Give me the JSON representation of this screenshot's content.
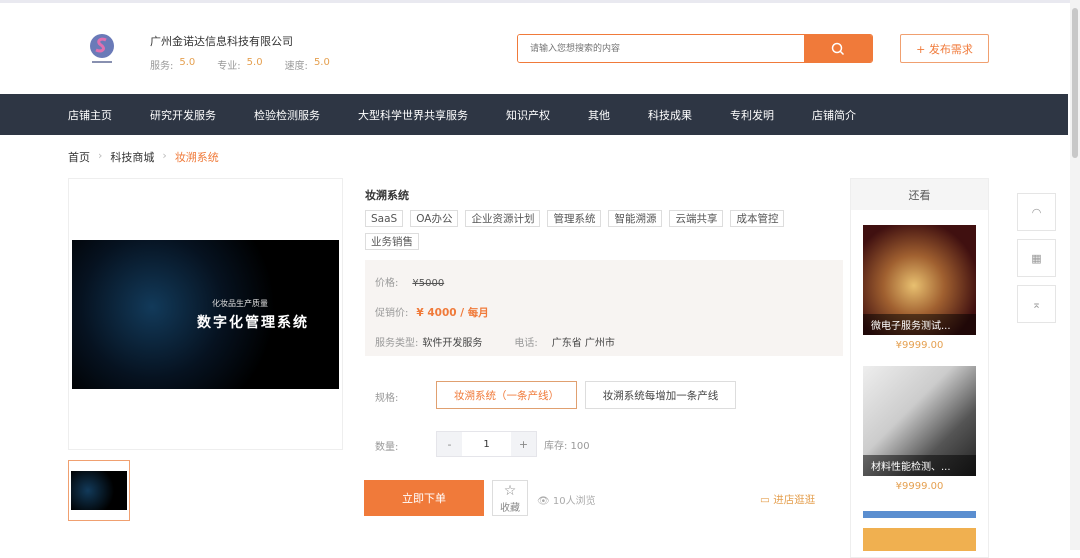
{
  "header": {
    "company": "广州金诺达信息科技有限公司",
    "ratings": [
      {
        "label": "服务:",
        "value": "5.0"
      },
      {
        "label": "专业:",
        "value": "5.0"
      },
      {
        "label": "速度:",
        "value": "5.0"
      }
    ],
    "search_placeholder": "请输入您想搜索的内容",
    "publish_label": "+ 发布需求"
  },
  "nav": [
    "店铺主页",
    "研究开发服务",
    "检验检测服务",
    "大型科学世界共享服务",
    "知识产权",
    "其他",
    "科技成果",
    "专利发明",
    "店铺简介"
  ],
  "breadcrumb": [
    "首页",
    "科技商城",
    "妆溯系统"
  ],
  "image": {
    "line1": "化妆品生产质量",
    "line2": "数字化管理系统"
  },
  "product": {
    "title": "妆溯系统",
    "tags": [
      "SaaS",
      "OA办公",
      "企业资源计划",
      "管理系统",
      "智能溯源",
      "云端共享",
      "成本管控",
      "业务销售"
    ],
    "price_label": "价格:",
    "price": "¥5000",
    "promo_label": "促销价:",
    "promo": "¥ 4000 / 每月",
    "type_label": "服务类型:",
    "type": "软件开发服务",
    "phone_label": "电话:",
    "phone": "广东省 广州市",
    "spec_label": "规格:",
    "specs": [
      "妆溯系统（一条产线）",
      "妆溯系统每增加一条产线"
    ],
    "qty_label": "数量:",
    "qty": "1",
    "minus": "-",
    "plus": "+",
    "stock": "库存: 100",
    "buy_label": "立即下单",
    "fav_label": "收藏",
    "views": "10人浏览",
    "shop_label": "进店逛逛"
  },
  "sidebar": {
    "title": "还看",
    "items": [
      {
        "name": "微电子服务测试...",
        "price": "¥9999.00"
      },
      {
        "name": "材料性能检测、...",
        "price": "¥9999.00"
      }
    ]
  },
  "colors": {
    "accent": "#f07a3a",
    "nav": "#2e3644"
  }
}
